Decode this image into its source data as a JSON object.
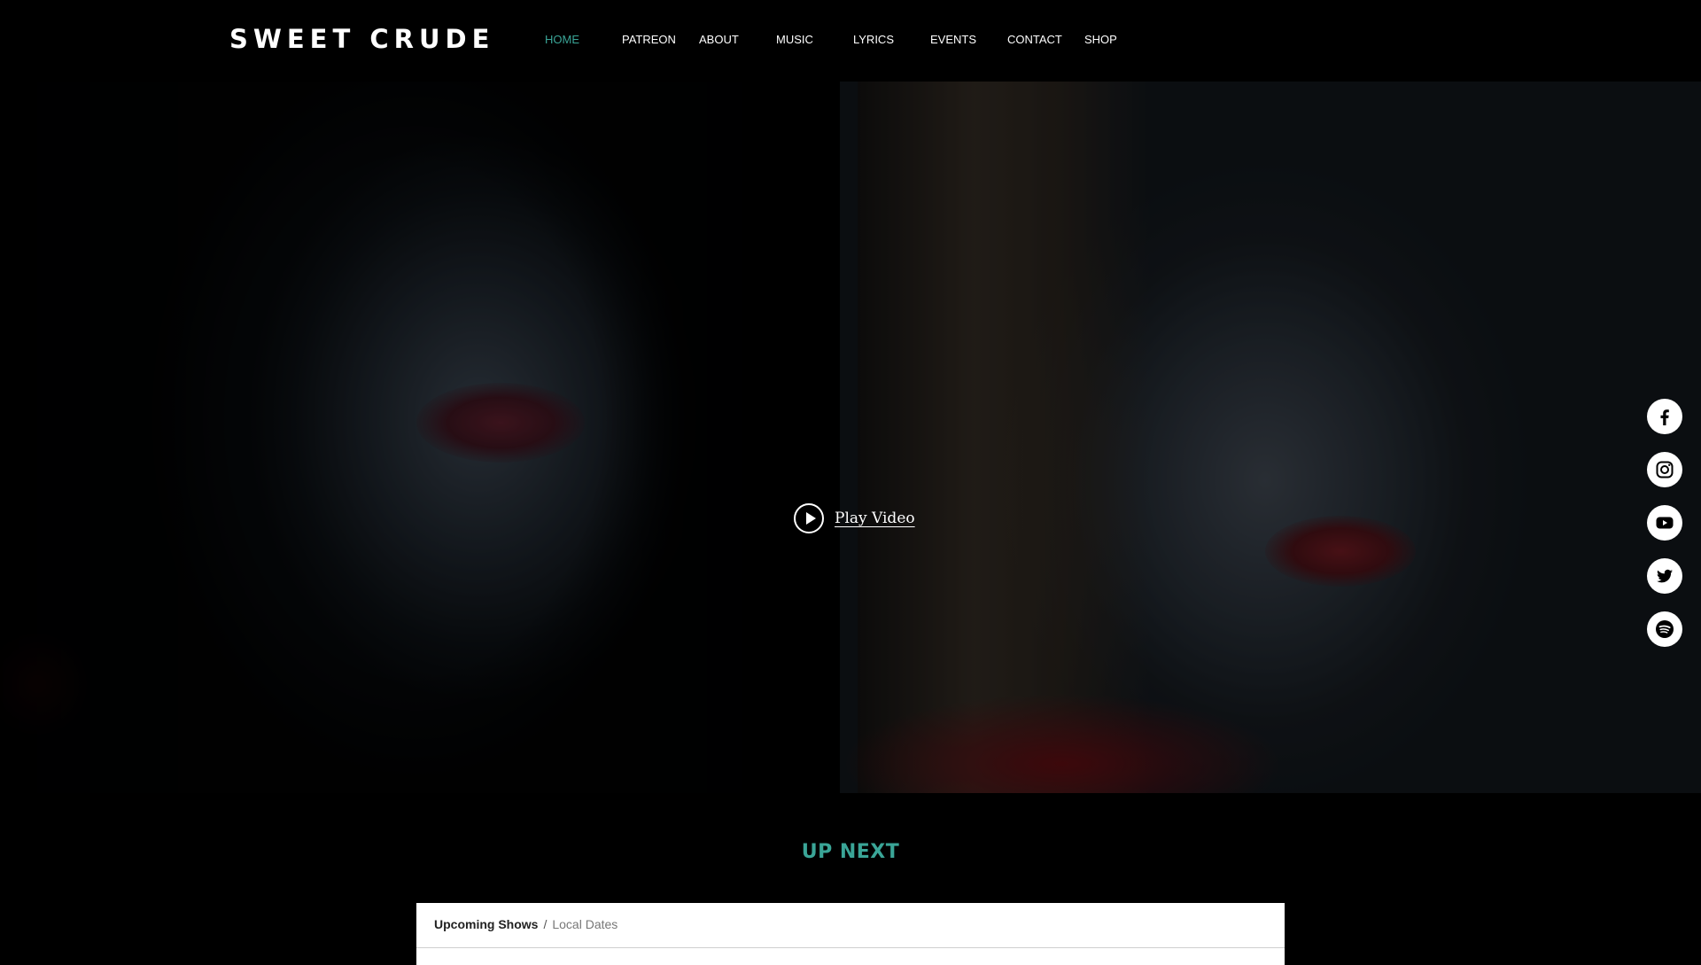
{
  "header": {
    "logo": "SWEET CRUDE",
    "nav": [
      {
        "label": "HOME",
        "active": true
      },
      {
        "label": "PATREON",
        "active": false
      },
      {
        "label": "ABOUT",
        "active": false
      },
      {
        "label": "MUSIC",
        "active": false
      },
      {
        "label": "LYRICS",
        "active": false
      },
      {
        "label": "EVENTS",
        "active": false
      },
      {
        "label": "CONTACT",
        "active": false
      },
      {
        "label": "SHOP",
        "active": false
      }
    ]
  },
  "hero": {
    "play_label": "Play Video",
    "play_icon": "play-circle-icon"
  },
  "social": [
    {
      "name": "facebook-icon"
    },
    {
      "name": "instagram-icon"
    },
    {
      "name": "youtube-icon"
    },
    {
      "name": "twitter-icon"
    },
    {
      "name": "spotify-icon"
    }
  ],
  "section": {
    "title": "UP NEXT",
    "tabs": {
      "upcoming": "Upcoming Shows",
      "separator": "/",
      "local": "Local Dates"
    }
  },
  "colors": {
    "accent": "#3aa597",
    "background": "#000000",
    "text": "#ffffff"
  }
}
